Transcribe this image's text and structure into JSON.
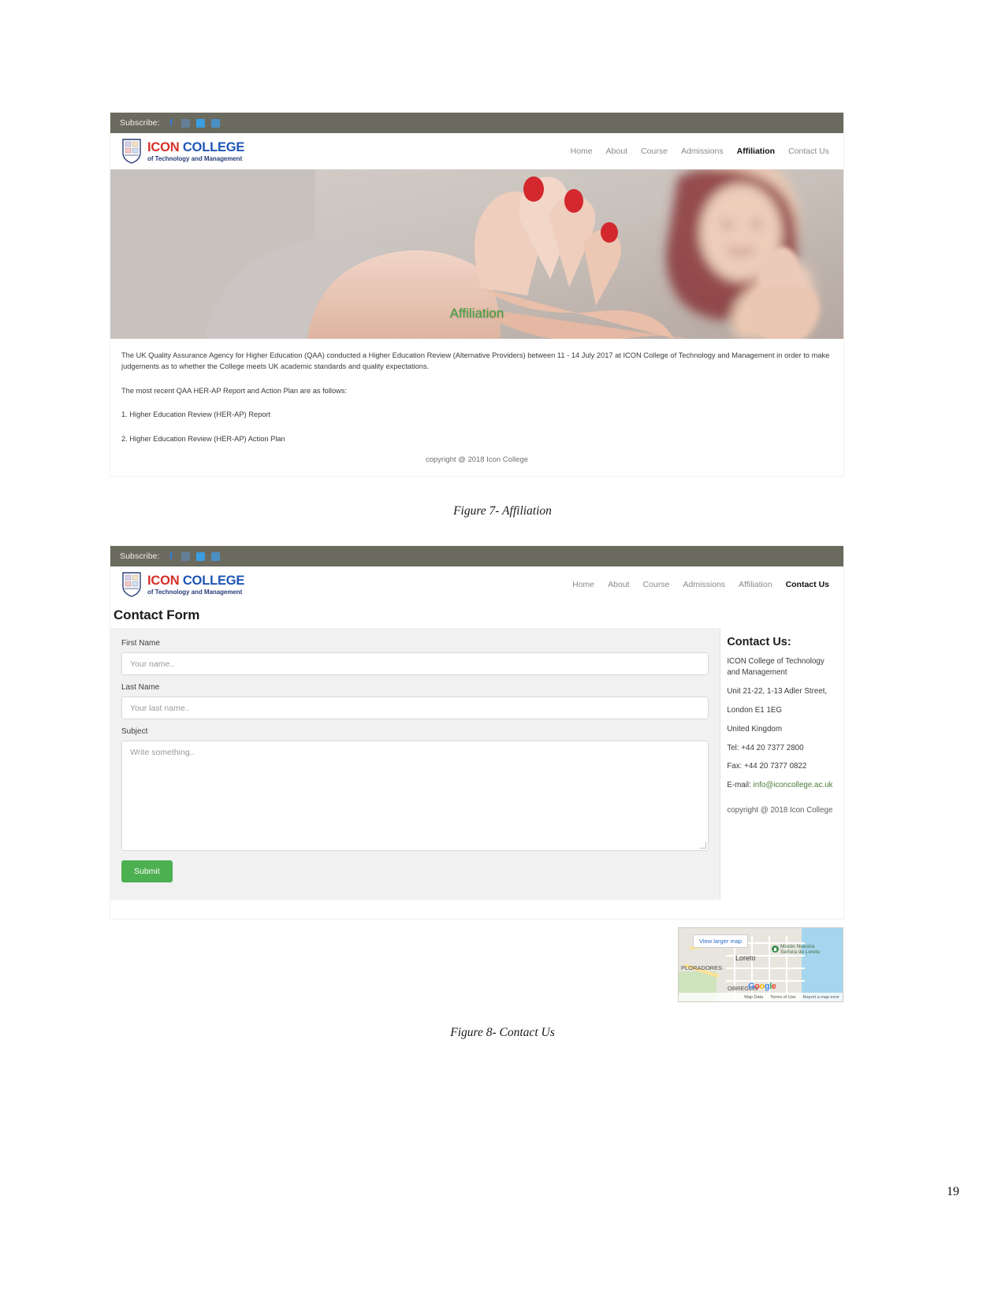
{
  "document": {
    "page_number": "19",
    "figures": [
      {
        "caption": "Figure 7- Affiliation"
      },
      {
        "caption": "Figure 8- Contact Us"
      }
    ]
  },
  "site": {
    "subscribe_label": "Subscribe:",
    "social_icons": [
      "facebook-icon",
      "googleplus-icon",
      "twitter-icon",
      "linkedin-icon"
    ],
    "brand": {
      "name_first": "ICON",
      "name_second": "COLLEGE",
      "tagline": "of Technology and Management",
      "crest_icon": "college-crest-icon",
      "color_first": "#d3302a",
      "color_second": "#1f56b5"
    },
    "nav": [
      {
        "label": "Home",
        "active": false
      },
      {
        "label": "About",
        "active": false
      },
      {
        "label": "Course",
        "active": false
      },
      {
        "label": "Admissions",
        "active": false
      },
      {
        "label": "Affiliation",
        "active": true
      },
      {
        "label": "Contact Us",
        "active": false
      }
    ],
    "nav_contact_active": [
      {
        "label": "Home"
      },
      {
        "label": "About"
      },
      {
        "label": "Course"
      },
      {
        "label": "Admissions"
      },
      {
        "label": "Affiliation"
      },
      {
        "label": "Contact Us"
      }
    ],
    "copyright": "copyright @ 2018 Icon College"
  },
  "affiliation_page": {
    "hero_caption": "Affiliation",
    "hero_caption_color": "#3fa23f",
    "paragraph_1": "The UK Quality Assurance Agency for Higher Education (QAA) conducted a Higher Education Review (Alternative Providers) between 11 - 14 July 2017 at ICON College of Technology and Management in order to make judgements as to whether the College meets UK academic standards and quality expectations.",
    "paragraph_2": "The most recent QAA HER-AP Report and Action Plan are as follows:",
    "list_item_1": "1. Higher Education Review (HER-AP) Report",
    "list_item_2": "2. Higher Education Review (HER-AP) Action Plan"
  },
  "contact_page": {
    "title": "Contact Form",
    "fields": [
      {
        "label": "First Name",
        "placeholder": "Your name..",
        "value": ""
      },
      {
        "label": "Last Name",
        "placeholder": "Your last name..",
        "value": ""
      },
      {
        "label": "Subject",
        "placeholder": "Write something..",
        "value": ""
      }
    ],
    "submit_label": "Submit",
    "submit_color": "#4caf50",
    "sidebar": {
      "heading": "Contact Us:",
      "org_line_1": "ICON College of Technology",
      "org_line_2": "and Management",
      "address_line_1": "Unit 21-22, 1-13 Adler Street,",
      "address_line_2": "London E1 1EG",
      "address_line_3": "United Kingdom",
      "tel": "Tel: +44 20 7377 2800",
      "fax": "Fax: +44 20 7377 0822",
      "email_label": "E-mail: ",
      "email_address": "info@iconcollege.ac.uk",
      "copyright": "copyright @ 2018 Icon College"
    },
    "map": {
      "view_larger": "View larger map",
      "labels": [
        {
          "text": "Loreto"
        },
        {
          "text": "PLORADORES"
        },
        {
          "text": "OBREGON"
        }
      ],
      "poi": "Misión Nuestra\nSeñora de Loreto",
      "brand": "Google",
      "footer": [
        "Map Data",
        "Terms of Use",
        "Report a map error"
      ]
    }
  }
}
